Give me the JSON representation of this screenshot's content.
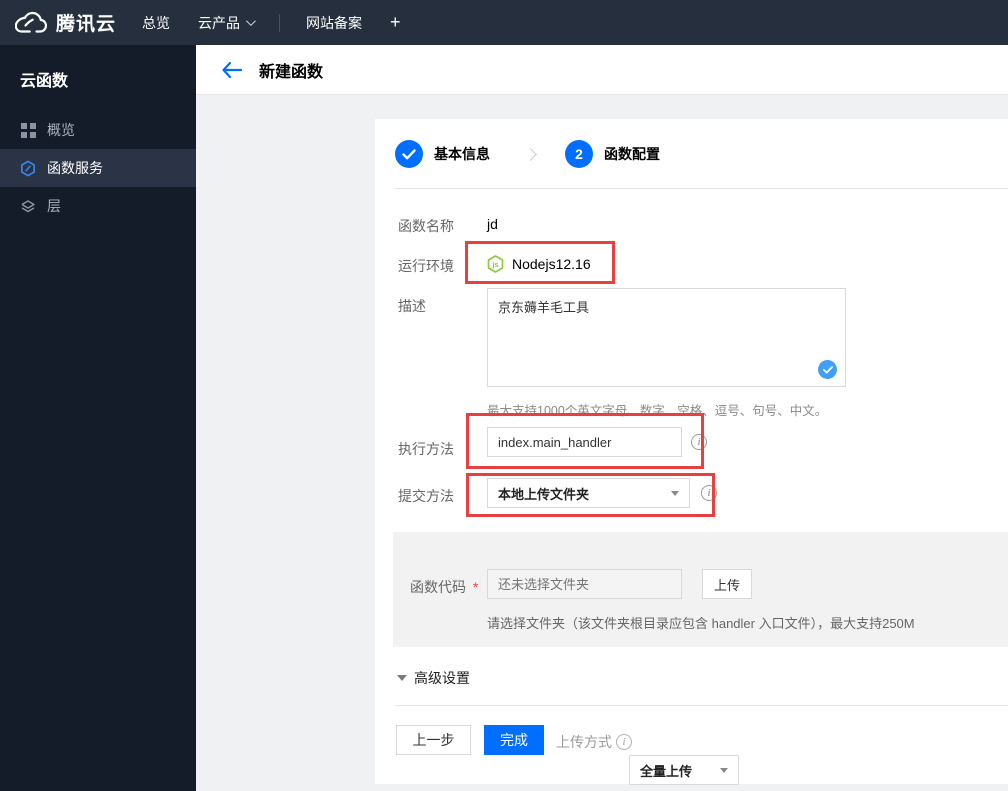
{
  "topbar": {
    "brand": "腾讯云",
    "nav": [
      {
        "label": "总览"
      },
      {
        "label": "云产品"
      },
      {
        "label": "网站备案"
      },
      {
        "label": "+"
      }
    ]
  },
  "sidebar": {
    "title": "云函数",
    "items": [
      {
        "label": "概览",
        "icon": "grid-icon",
        "active": false
      },
      {
        "label": "函数服务",
        "icon": "function-hexagon-icon",
        "active": true
      },
      {
        "label": "层",
        "icon": "layers-icon",
        "active": false
      }
    ]
  },
  "header": {
    "title": "新建函数"
  },
  "steps": {
    "step1_label": "基本信息",
    "step2_number": "2",
    "step2_label": "函数配置"
  },
  "form": {
    "name_label": "函数名称",
    "name_value": "jd",
    "runtime_label": "运行环境",
    "runtime_value": "Nodejs12.16",
    "runtime_icon": "nodejs-icon",
    "desc_label": "描述",
    "desc_value": "京东薅羊毛工具",
    "desc_hint": "最大支持1000个英文字母、数字、空格、逗号、句号、中文。",
    "handler_label": "执行方法",
    "handler_value": "index.main_handler",
    "submit_label": "提交方法",
    "submit_value": "本地上传文件夹",
    "code_label": "函数代码",
    "code_required_mark": "*",
    "code_placeholder": "还未选择文件夹",
    "code_upload_button": "上传",
    "code_hint": "请选择文件夹（该文件夹根目录应包含 handler 入口文件），最大支持250M",
    "advanced_label": "高级设置"
  },
  "footer": {
    "prev_button": "上一步",
    "finish_button": "完成",
    "upload_mode_label": "上传方式",
    "upload_mode_value": "全量上传"
  },
  "colors": {
    "accent_blue": "#006eff",
    "highlight_red": "#e84040",
    "node_green": "#8cc540",
    "valid_bubble_blue": "#41a0f6",
    "topbar_bg": "#262f3e",
    "sidebar_bg": "#151c29",
    "sidebar_active_bg": "#2a3446"
  }
}
